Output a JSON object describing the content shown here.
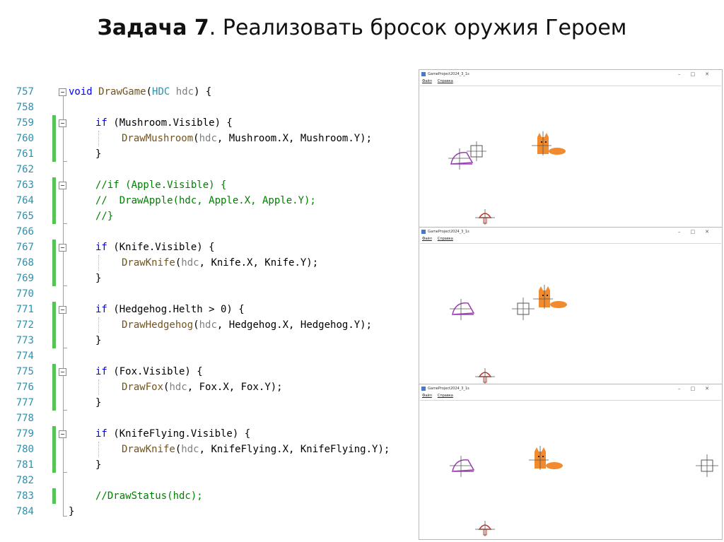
{
  "slide": {
    "title_bold": "Задача 7",
    "title_rest": ". Реализовать бросок оружия Героем"
  },
  "code": {
    "lines": [
      {
        "num": "757"
      },
      {
        "num": "758"
      },
      {
        "num": "759"
      },
      {
        "num": "760"
      },
      {
        "num": "761"
      },
      {
        "num": "762"
      },
      {
        "num": "763"
      },
      {
        "num": "764"
      },
      {
        "num": "765"
      },
      {
        "num": "766"
      },
      {
        "num": "767"
      },
      {
        "num": "768"
      },
      {
        "num": "769"
      },
      {
        "num": "770"
      },
      {
        "num": "771"
      },
      {
        "num": "772"
      },
      {
        "num": "773"
      },
      {
        "num": "774"
      },
      {
        "num": "775"
      },
      {
        "num": "776"
      },
      {
        "num": "777"
      },
      {
        "num": "778"
      },
      {
        "num": "779"
      },
      {
        "num": "780"
      },
      {
        "num": "781"
      },
      {
        "num": "782"
      },
      {
        "num": "783"
      },
      {
        "num": "784"
      }
    ]
  },
  "windows": [
    {
      "title": "GameProject2024_3_1s",
      "menu_file": "Файл",
      "menu_help": "Справка"
    },
    {
      "title": "GameProject2024_3_1s",
      "menu_file": "Файл",
      "menu_help": "Справка"
    },
    {
      "title": "GameProject2024_3_1s",
      "menu_file": "Файл",
      "menu_help": "Справка"
    }
  ],
  "colors": {
    "line_number": "#2b91af",
    "keyword": "#0000ff",
    "function": "#74531f",
    "comment": "#008000",
    "change_bar": "#57c457",
    "fox": "#f28a2e",
    "hedgehog": "#9b3fb5",
    "mushroom": "#c0392b"
  },
  "icons": [
    "collapse-icon",
    "fox-sprite",
    "hedgehog-sprite",
    "mushroom-sprite",
    "knife-crosshair"
  ]
}
